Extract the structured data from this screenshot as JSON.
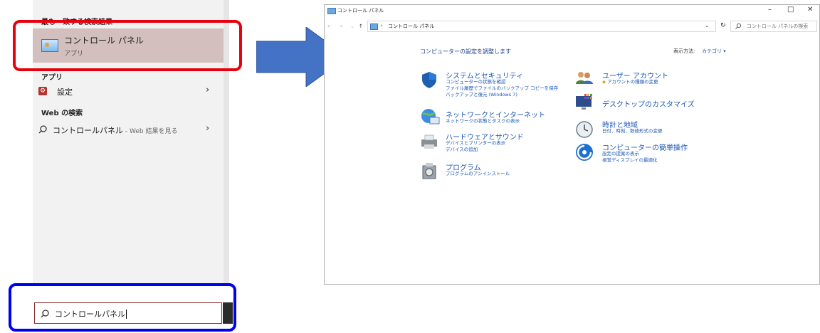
{
  "start_menu": {
    "best_match_heading": "最も一致する検索結果",
    "best_match": {
      "title": "コントロール パネル",
      "subtitle": "アプリ"
    },
    "apps_heading": "アプリ",
    "apps": [
      {
        "label": "設定"
      }
    ],
    "web_heading": "Web の検索",
    "web_result": {
      "label": "コントロールパネル",
      "suffix": " - Web 結果を見る"
    },
    "search_value": "コントロールパネル"
  },
  "window": {
    "title": "コントロール パネル",
    "controls": {
      "minimize": "–",
      "maximize": "□",
      "close": "✕"
    },
    "address": "コントロール パネル",
    "search_placeholder": "コントロール パネルの検索",
    "heading": "コンピューターの設定を調整します",
    "view_by_label": "表示方法:",
    "view_by_value": "カテゴリ ▾",
    "categories_left": [
      {
        "title": "システムとセキュリティ",
        "links": [
          "コンピューターの状態を確認",
          "ファイル履歴でファイルのバックアップ コピーを保存",
          "バックアップと復元 (Windows 7)"
        ]
      },
      {
        "title": "ネットワークとインターネット",
        "links": [
          "ネットワークの状態とタスクの表示"
        ]
      },
      {
        "title": "ハードウェアとサウンド",
        "links": [
          "デバイスとプリンターの表示",
          "デバイスの追加"
        ]
      },
      {
        "title": "プログラム",
        "links": [
          "プログラムのアンインストール"
        ]
      }
    ],
    "categories_right": [
      {
        "title": "ユーザー アカウント",
        "links": [
          "アカウントの種類の変更"
        ]
      },
      {
        "title": "デスクトップのカスタマイズ",
        "links": []
      },
      {
        "title": "時計と地域",
        "links": [
          "日付、時刻、数値形式の変更"
        ]
      },
      {
        "title": "コンピューターの簡単操作",
        "links": [
          "設定の提案の表示",
          "視覚ディスプレイの最適化"
        ]
      }
    ]
  },
  "colors": {
    "highlight": "#d4bfbf",
    "red_box": "#e8000d",
    "blue_box": "#0000ee",
    "arrow": "#4472c4",
    "link": "#1a56b5"
  }
}
